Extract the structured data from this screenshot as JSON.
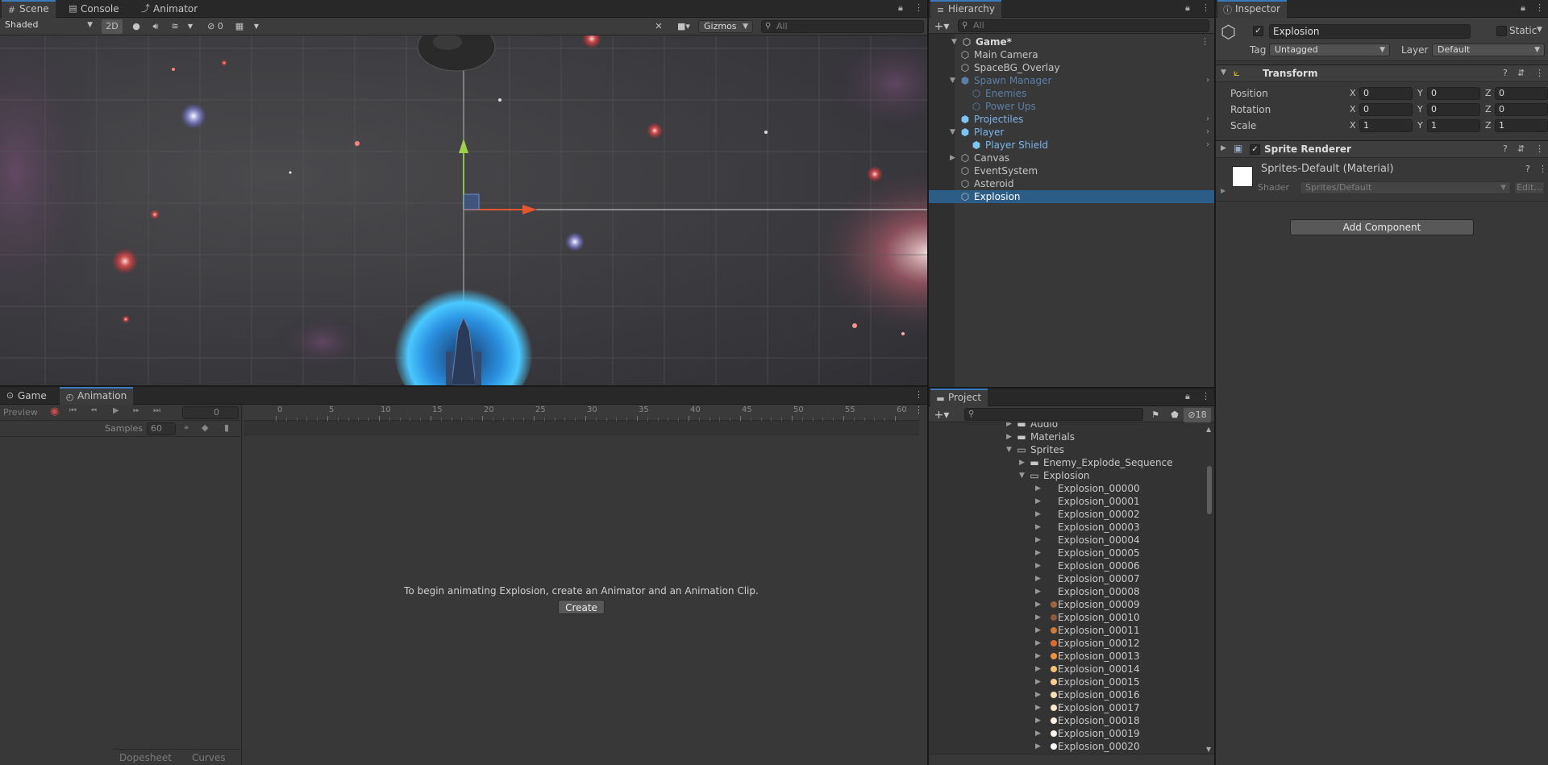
{
  "scene_panel": {
    "tabs": [
      {
        "label": "Scene",
        "icon": "scene-grid-icon"
      },
      {
        "label": "Console",
        "icon": "console-icon"
      },
      {
        "label": "Animator",
        "icon": "animator-icon"
      }
    ],
    "toolbar": {
      "draw_mode": "Shaded",
      "mode_2d": "2D",
      "hidden_count": "0",
      "gizmos": "Gizmos",
      "search_placeholder": "All"
    }
  },
  "animation_panel": {
    "tabs": [
      {
        "label": "Game",
        "icon": "gamepad-icon"
      },
      {
        "label": "Animation",
        "icon": "clock-icon"
      }
    ],
    "preview_label": "Preview",
    "frame_value": "0",
    "samples_label": "Samples",
    "samples_value": "60",
    "ruler_ticks": [
      "0",
      "5",
      "10",
      "15",
      "20",
      "25",
      "30",
      "35",
      "40",
      "45",
      "50",
      "55",
      "60"
    ],
    "message": "To begin animating Explosion, create an Animator and an Animation Clip.",
    "create_label": "Create",
    "bottom_tabs": [
      "Dopesheet",
      "Curves"
    ]
  },
  "hierarchy": {
    "title": "Hierarchy",
    "search_placeholder": "All",
    "items": [
      {
        "label": "Game*",
        "depth": 0,
        "fold": "open",
        "kind": "scene",
        "color": "#d8d8d8",
        "bold": true,
        "selected": false
      },
      {
        "label": "Main Camera",
        "depth": 1,
        "fold": "",
        "kind": "object",
        "color": "#c4c4c4",
        "bold": false,
        "selected": false
      },
      {
        "label": "SpaceBG_Overlay",
        "depth": 1,
        "fold": "",
        "kind": "object",
        "color": "#c4c4c4",
        "bold": false,
        "selected": false
      },
      {
        "label": "Spawn Manager",
        "depth": 1,
        "fold": "open",
        "kind": "prefab-dim",
        "color": "#5c7fa8",
        "bold": false,
        "selected": false,
        "arrow": true
      },
      {
        "label": "Enemies",
        "depth": 2,
        "fold": "",
        "kind": "object-dim",
        "color": "#5c7fa8",
        "bold": false,
        "selected": false
      },
      {
        "label": "Power Ups",
        "depth": 2,
        "fold": "",
        "kind": "object-dim",
        "color": "#5c7fa8",
        "bold": false,
        "selected": false
      },
      {
        "label": "Projectiles",
        "depth": 1,
        "fold": "",
        "kind": "prefab",
        "color": "#7cb5ec",
        "bold": false,
        "selected": false,
        "arrow": true
      },
      {
        "label": "Player",
        "depth": 1,
        "fold": "open",
        "kind": "prefab",
        "color": "#7cb5ec",
        "bold": false,
        "selected": false,
        "arrow": true
      },
      {
        "label": "Player Shield",
        "depth": 2,
        "fold": "",
        "kind": "prefab",
        "color": "#7cb5ec",
        "bold": false,
        "selected": false,
        "arrow": true
      },
      {
        "label": "Canvas",
        "depth": 1,
        "fold": "closed",
        "kind": "object",
        "color": "#c4c4c4",
        "bold": false,
        "selected": false
      },
      {
        "label": "EventSystem",
        "depth": 1,
        "fold": "",
        "kind": "object",
        "color": "#c4c4c4",
        "bold": false,
        "selected": false
      },
      {
        "label": "Asteroid",
        "depth": 1,
        "fold": "",
        "kind": "object",
        "color": "#c4c4c4",
        "bold": false,
        "selected": false
      },
      {
        "label": "Explosion",
        "depth": 1,
        "fold": "",
        "kind": "object",
        "color": "#ffffff",
        "bold": false,
        "selected": true
      }
    ]
  },
  "project": {
    "title": "Project",
    "hidden_count": "18",
    "folders": [
      {
        "label": "Audio",
        "depth": 0,
        "fold": "closed",
        "kind": "folder"
      },
      {
        "label": "Materials",
        "depth": 0,
        "fold": "closed",
        "kind": "folder"
      },
      {
        "label": "Sprites",
        "depth": 0,
        "fold": "open",
        "kind": "folder-open"
      },
      {
        "label": "Enemy_Explode_Sequence",
        "depth": 1,
        "fold": "closed",
        "kind": "folder"
      },
      {
        "label": "Explosion",
        "depth": 1,
        "fold": "open",
        "kind": "folder-open"
      }
    ],
    "sprites": [
      {
        "label": "Explosion_00000",
        "thumb": ""
      },
      {
        "label": "Explosion_00001",
        "thumb": ""
      },
      {
        "label": "Explosion_00002",
        "thumb": ""
      },
      {
        "label": "Explosion_00003",
        "thumb": ""
      },
      {
        "label": "Explosion_00004",
        "thumb": ""
      },
      {
        "label": "Explosion_00005",
        "thumb": ""
      },
      {
        "label": "Explosion_00006",
        "thumb": ""
      },
      {
        "label": "Explosion_00007",
        "thumb": ""
      },
      {
        "label": "Explosion_00008",
        "thumb": ""
      },
      {
        "label": "Explosion_00009",
        "thumb": "#a0643c"
      },
      {
        "label": "Explosion_00010",
        "thumb": "#8a5a3a"
      },
      {
        "label": "Explosion_00011",
        "thumb": "#d07a3a"
      },
      {
        "label": "Explosion_00012",
        "thumb": "#e06a2a"
      },
      {
        "label": "Explosion_00013",
        "thumb": "#f09040"
      },
      {
        "label": "Explosion_00014",
        "thumb": "#f5c070"
      },
      {
        "label": "Explosion_00015",
        "thumb": "#f7d090"
      },
      {
        "label": "Explosion_00016",
        "thumb": "#f9e0b0"
      },
      {
        "label": "Explosion_00017",
        "thumb": "#fbe8c8"
      },
      {
        "label": "Explosion_00018",
        "thumb": "#fdf2e0"
      },
      {
        "label": "Explosion_00019",
        "thumb": "#fef8ee"
      },
      {
        "label": "Explosion_00020",
        "thumb": "#fffaf4"
      }
    ]
  },
  "inspector": {
    "title": "Inspector",
    "object_name": "Explosion",
    "static_label": "Static",
    "tag_label": "Tag",
    "tag_value": "Untagged",
    "layer_label": "Layer",
    "layer_value": "Default",
    "transform": {
      "title": "Transform",
      "rows": [
        {
          "label": "Position",
          "x": "0",
          "y": "0",
          "z": "0"
        },
        {
          "label": "Rotation",
          "x": "0",
          "y": "0",
          "z": "0"
        },
        {
          "label": "Scale",
          "x": "1",
          "y": "1",
          "z": "1"
        }
      ],
      "axis_labels": [
        "X",
        "Y",
        "Z"
      ]
    },
    "sprite_renderer": {
      "title": "Sprite Renderer",
      "material": "Sprites-Default (Material)",
      "shader_label": "Shader",
      "shader_value": "Sprites/Default",
      "edit_label": "Edit..."
    },
    "add_component": "Add Component"
  }
}
